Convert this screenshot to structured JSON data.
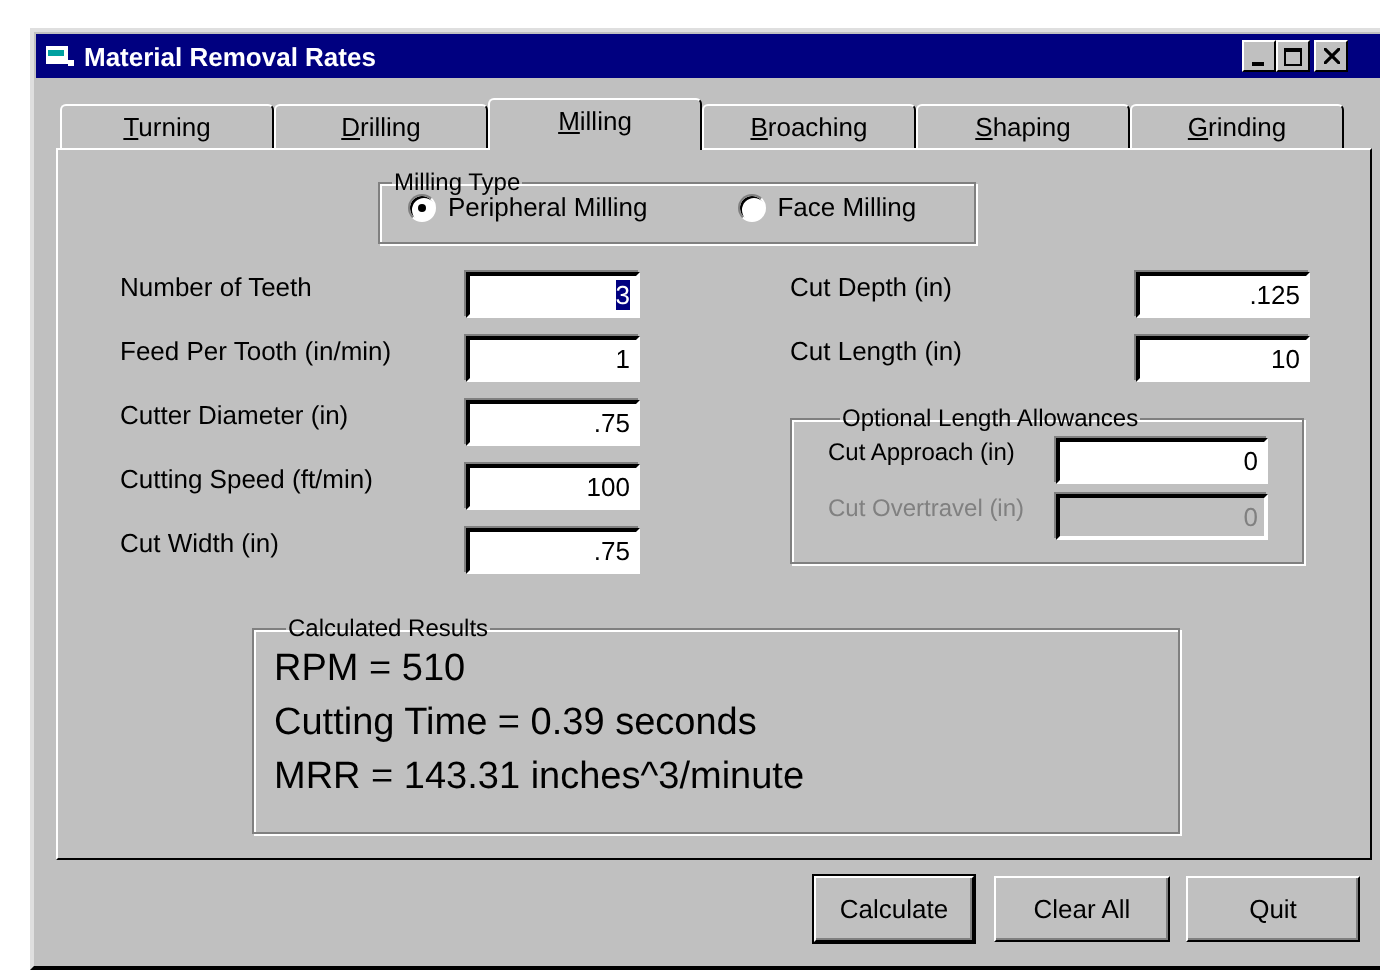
{
  "window": {
    "title": "Material Removal Rates"
  },
  "tabs": [
    {
      "label": "Turning",
      "selected": false
    },
    {
      "label": "Drilling",
      "selected": false
    },
    {
      "label": "Milling",
      "selected": true
    },
    {
      "label": "Broaching",
      "selected": false
    },
    {
      "label": "Shaping",
      "selected": false
    },
    {
      "label": "Grinding",
      "selected": false
    }
  ],
  "milling_type": {
    "title": "Milling Type",
    "options": [
      {
        "label": "Peripheral Milling",
        "selected": true
      },
      {
        "label": "Face Milling",
        "selected": false
      }
    ]
  },
  "left_fields": [
    {
      "label": "Number of Teeth",
      "value": "3",
      "highlighted": true
    },
    {
      "label": "Feed Per Tooth (in/min)",
      "value": "1",
      "highlighted": false
    },
    {
      "label": "Cutter Diameter  (in)",
      "value": ".75",
      "highlighted": false
    },
    {
      "label": "Cutting Speed (ft/min)",
      "value": "100",
      "highlighted": false
    },
    {
      "label": "Cut Width (in)",
      "value": ".75",
      "highlighted": false
    }
  ],
  "right_fields": [
    {
      "label": "Cut Depth (in)",
      "value": ".125"
    },
    {
      "label": "Cut Length (in)",
      "value": "10"
    }
  ],
  "allowances": {
    "title": "Optional Length Allowances",
    "fields": [
      {
        "label": "Cut Approach  (in)",
        "value": "0",
        "disabled": false
      },
      {
        "label": "Cut Overtravel (in)",
        "value": "0",
        "disabled": true
      }
    ]
  },
  "results": {
    "title": "Calculated Results",
    "lines": [
      "RPM = 510",
      "Cutting Time = 0.39 seconds",
      "MRR = 143.31 inches^3/minute"
    ]
  },
  "buttons": [
    {
      "label": "Calculate",
      "default": true
    },
    {
      "label": "Clear All",
      "default": false
    },
    {
      "label": "Quit",
      "default": false
    }
  ]
}
